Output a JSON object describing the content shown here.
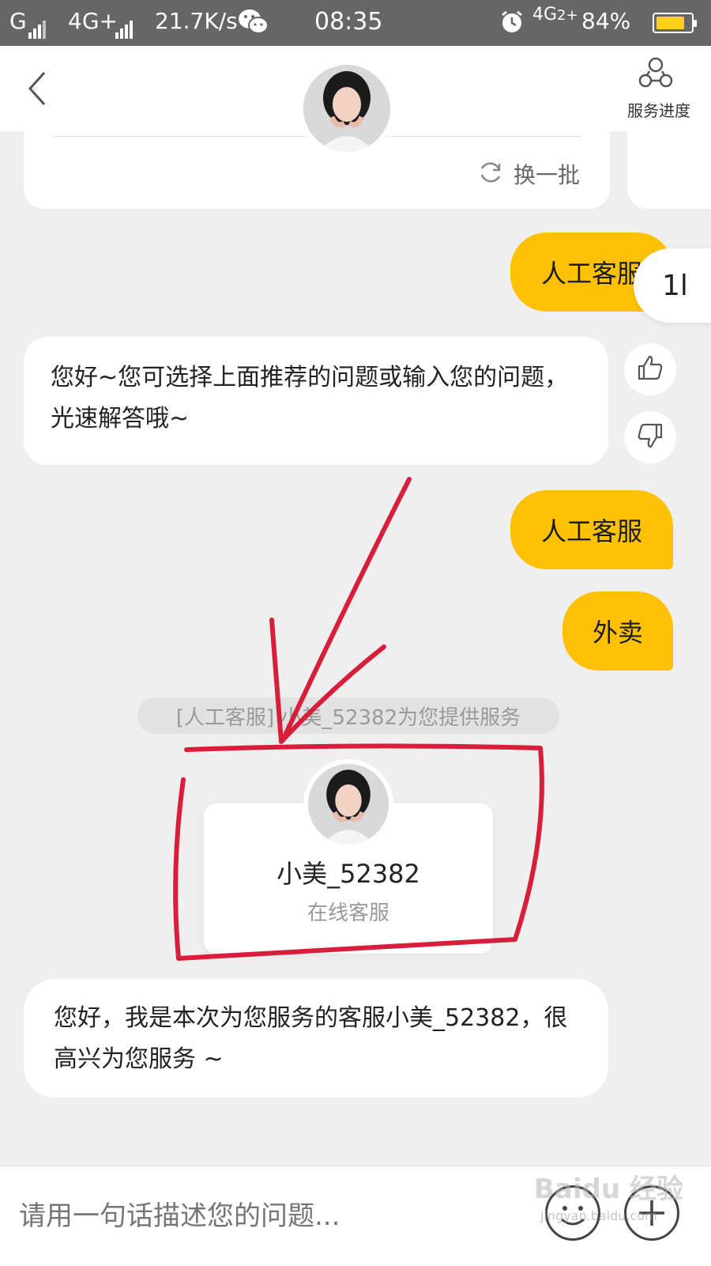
{
  "status_bar": {
    "carrier1": "G",
    "carrier2": "4G+",
    "net_speed": "21.7K/s",
    "time": "08:35",
    "net_type": "4G",
    "net_type_sub": "2+",
    "battery": "84%",
    "battery_level": 0.84,
    "icons": [
      "signal-icon",
      "wechat-icon",
      "alarm-icon",
      "battery-icon"
    ]
  },
  "header": {
    "back_icon": "chevron-left-icon",
    "service_progress_label": "服务进度",
    "service_progress_icon": "nodes-icon"
  },
  "top_card": {
    "refresh_label": "换一批",
    "refresh_icon": "refresh-icon"
  },
  "messages": {
    "user1": "人工客服",
    "bot_reply": "您好~您可选择上面推荐的问题或输入您的问题，光速解答哦~",
    "user2": "人工客服",
    "user3": "外卖",
    "system": "[人工客服] 小美_52382为您提供服务",
    "agent_greeting": "您好，我是本次为您服务的客服小美_52382，很高兴为您服务 ~"
  },
  "scroll_button_label": "1l",
  "agent_card": {
    "name": "小美_52382",
    "role": "在线客服"
  },
  "feedback": {
    "like_icon": "thumbs-up-icon",
    "dislike_icon": "thumbs-down-icon"
  },
  "input": {
    "placeholder": "请用一句话描述您的问题..."
  },
  "watermark": {
    "brand": "Baidu 经验",
    "url": "jingyan.baidu.com"
  },
  "colors": {
    "accent": "#ffc107",
    "annotation": "#d81e3a",
    "background": "#efefef",
    "status_bar": "#666666"
  }
}
